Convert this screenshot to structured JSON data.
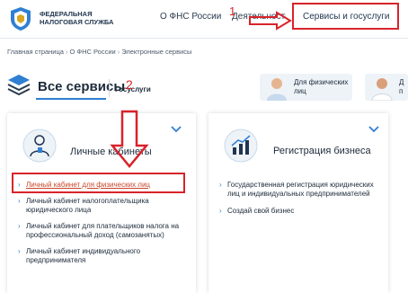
{
  "header": {
    "org_name_line1": "ФЕДЕРАЛЬНАЯ",
    "org_name_line2": "НАЛОГОВАЯ СЛУЖБА",
    "nav": {
      "about": "О ФНС России",
      "activity": "Деятельность",
      "services": "Сервисы и госуслуги"
    }
  },
  "breadcrumb": {
    "items": [
      "Главная страница",
      "О ФНС России",
      "Электронные сервисы"
    ]
  },
  "section": {
    "title": "Все сервисы",
    "tab_services": "Госуслуги"
  },
  "tiles": [
    {
      "label_line1": "Для физических",
      "label_line2": "лиц"
    },
    {
      "label_line1": "Д",
      "label_line2": "п"
    }
  ],
  "cards": {
    "personal_accounts": {
      "title": "Личные кабинеты",
      "items": [
        "Личный кабинет для физических лиц",
        "Личный кабинет налогоплательщика юридического лица",
        "Личный кабинет для плательщиков налога на профессиональный доход (самозанятых)",
        "Личный кабинет индивидуального предпринимателя"
      ]
    },
    "business_registration": {
      "title": "Регистрация бизнеса",
      "items": [
        "Государственная регистрация юридических лиц и индивидуальных предпринимателей",
        "Создай свой бизнес"
      ]
    }
  },
  "annotations": {
    "step1": "1",
    "step2": "2"
  },
  "colors": {
    "annotation_red": "#d8232a",
    "accent_blue": "#2f7fd2",
    "link_visited": "#c9452a"
  }
}
